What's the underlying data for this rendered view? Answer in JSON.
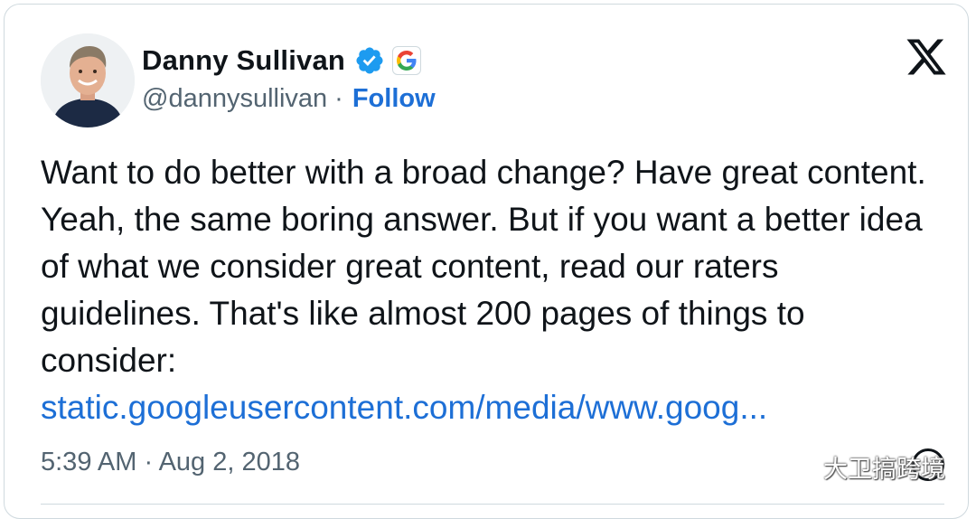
{
  "tweet": {
    "author_name": "Danny Sullivan",
    "handle": "@dannysullivan",
    "separator": "·",
    "follow_label": "Follow",
    "text": "Want to do better with a broad change? Have great content. Yeah, the same boring answer. But if you want a better idea of what we consider great content, read our raters guidelines. That's like almost 200 pages of things to consider:",
    "link_text": "static.googleusercontent.com/media/www.goog...",
    "timestamp": "5:39 AM · Aug 2, 2018"
  },
  "badges": {
    "verified_icon": "verified-check-icon",
    "affiliation_icon": "google-g-icon",
    "platform_icon": "x-logo-icon"
  },
  "watermark": {
    "text": "大卫搞跨境",
    "icon": "wechat-icon"
  },
  "colors": {
    "accent": "#1d6fd6",
    "text_primary": "#0f1419",
    "text_secondary": "#536471",
    "border": "#cfd9de",
    "verified": "#1d9bf0"
  }
}
